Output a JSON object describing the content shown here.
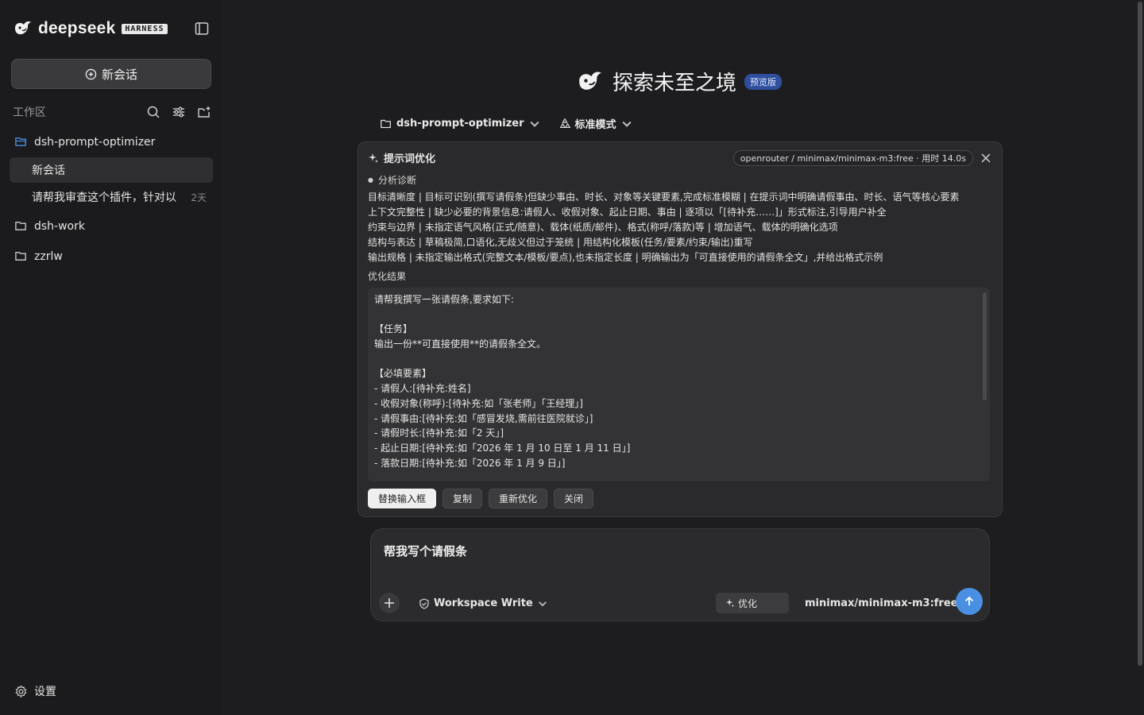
{
  "brand": {
    "name": "deepseek",
    "badge": "HARNESS"
  },
  "sidebar": {
    "new_chat_label": "新会话",
    "workspace_label": "工作区",
    "workspaces": [
      {
        "name": "dsh-prompt-optimizer"
      },
      {
        "name": "dsh-work"
      },
      {
        "name": "zzrlw"
      }
    ],
    "sessions": [
      {
        "title": "新会话",
        "time": ""
      },
      {
        "title": "请帮我审查这个插件，针对以",
        "time": "2天"
      }
    ],
    "settings_label": "设置"
  },
  "hero": {
    "title": "探索未至之境",
    "badge": "预览版"
  },
  "context": {
    "project": "dsh-prompt-optimizer",
    "mode": "标准模式"
  },
  "panel": {
    "title": "提示词优化",
    "model_info": "openrouter / minimax/minimax-m3:free · 用时 14.0s",
    "diagnosis_label": "分析诊断",
    "diagnosis": [
      "目标清晰度 | 目标可识别(撰写请假条)但缺少事由、时长、对象等关键要素,完成标准模糊 | 在提示词中明确请假事由、时长、语气等核心要素",
      "上下文完整性 | 缺少必要的背景信息:请假人、收假对象、起止日期、事由 | 逐项以「[待补充……]」形式标注,引导用户补全",
      "约束与边界 | 未指定语气风格(正式/随意)、载体(纸质/邮件)、格式(称呼/落款)等 | 增加语气、载体的明确化选项",
      "结构与表达 | 草稿极简,口语化,无歧义但过于笼统 | 用结构化模板(任务/要素/约束/输出)重写",
      "输出规格 | 未指定输出格式(完整文本/模板/要点),也未指定长度 | 明确输出为「可直接使用的请假条全文」,并给出格式示例"
    ],
    "result_label": "优化结果",
    "result_lines": [
      "请帮我撰写一张请假条,要求如下:",
      "",
      "【任务】",
      "输出一份**可直接使用**的请假条全文。",
      "",
      "【必填要素】",
      "- 请假人:[待补充:姓名]",
      "- 收假对象(称呼):[待补充:如「张老师」「王经理」]",
      "- 请假事由:[待补充:如「感冒发烧,需前往医院就诊」]",
      "- 请假时长:[待补充:如「2 天」]",
      "- 起止日期:[待补充:如「2026 年 1 月 10 日至 1 月 11 日」]",
      "- 落款日期:[待补充:如「2026 年 1 月 9 日」]"
    ],
    "actions": {
      "replace": "替换输入框",
      "copy": "复制",
      "reoptimize": "重新优化",
      "close": "关闭"
    }
  },
  "composer": {
    "text": "帮我写个请假条",
    "permission": "Workspace Write",
    "optimize_label": "优化",
    "model": "minimax/minimax-m3:free"
  },
  "colors": {
    "accent": "#4a90e2",
    "badge": "#2f4f9e",
    "background": "#1d1d20"
  }
}
